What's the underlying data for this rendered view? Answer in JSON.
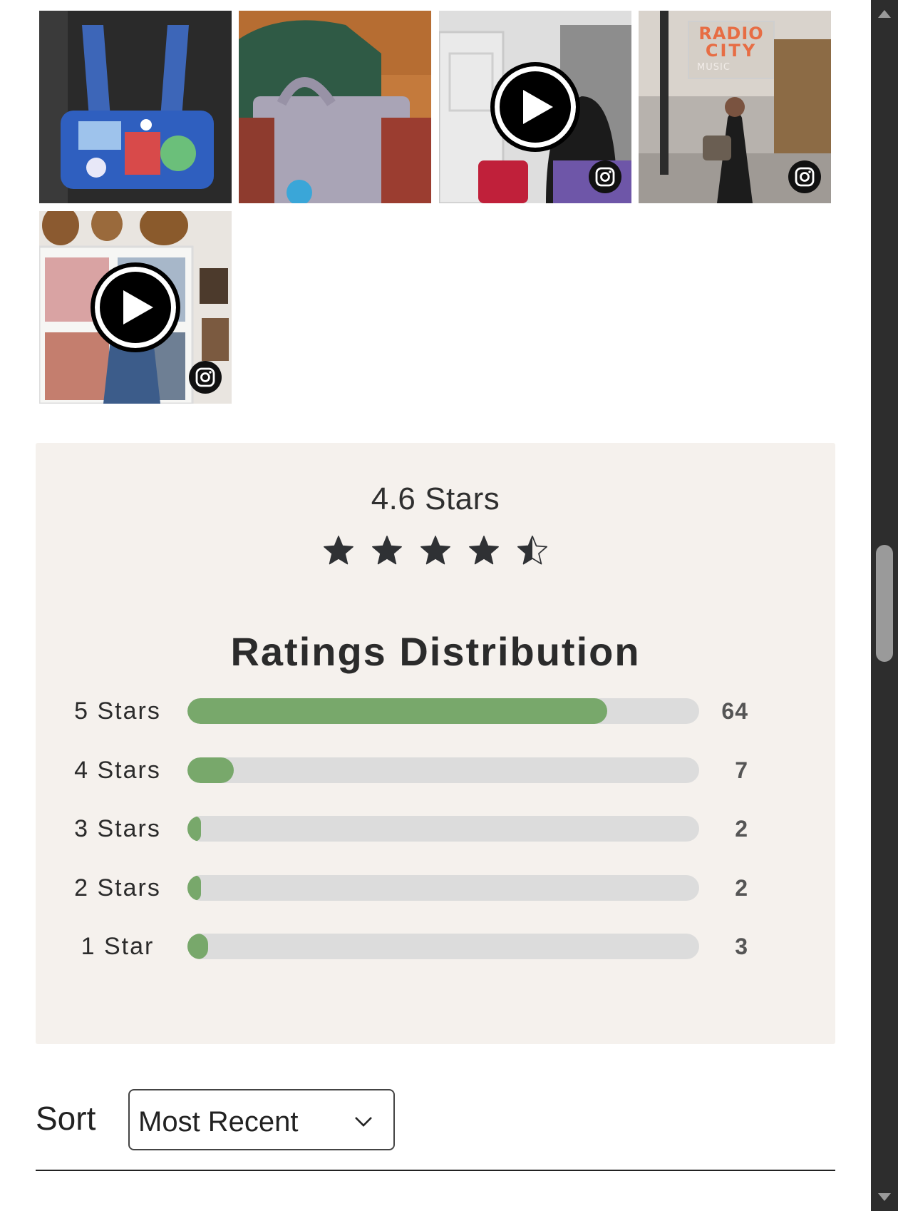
{
  "gallery": {
    "tiles": [
      {
        "name": "blue-floral-duffel",
        "video": false,
        "instagram": false
      },
      {
        "name": "lavender-quilted-bag",
        "video": false,
        "instagram": false
      },
      {
        "name": "red-handbag-door",
        "video": true,
        "instagram": true
      },
      {
        "name": "radio-city-photo",
        "video": false,
        "instagram": true
      },
      {
        "name": "bookshelf-video",
        "video": true,
        "instagram": true
      }
    ],
    "radio_city_sign": {
      "line1": "RADIO",
      "line2": "CITY",
      "line3": "MUSIC"
    }
  },
  "ratings": {
    "average_text": "4.6 Stars",
    "average_value": 4.6,
    "title": "Ratings Distribution",
    "rows": [
      {
        "label": "5 Stars",
        "count": "64",
        "fill": 0.82
      },
      {
        "label": "4 Stars",
        "count": "7",
        "fill": 0.09
      },
      {
        "label": "3 Stars",
        "count": "2",
        "fill": 0.027
      },
      {
        "label": "2 Stars",
        "count": "2",
        "fill": 0.027
      },
      {
        "label": "1 Star",
        "count": "3",
        "fill": 0.04
      }
    ]
  },
  "sort": {
    "label": "Sort",
    "selected": "Most Recent"
  },
  "colors": {
    "panel_bg": "#f5f1ed",
    "bar_fill": "#78a86b",
    "bar_track": "#dcdcdc"
  }
}
